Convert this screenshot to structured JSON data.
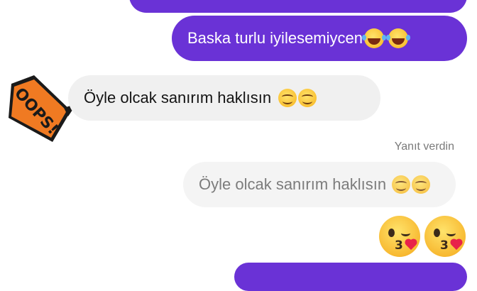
{
  "messages": {
    "sent_top": {
      "text": ""
    },
    "sent_1": {
      "text": "Baska turlu iyilesemiycen",
      "emojis": [
        "face-with-tears-of-joy",
        "face-with-tears-of-joy"
      ]
    },
    "received_1": {
      "text": "Öyle olcak sanırım haklısın",
      "emojis": [
        "smiling-face",
        "smiling-face"
      ]
    },
    "reply_meta": "Yanıt verdin",
    "quoted": {
      "text": "Öyle olcak sanırım haklısın",
      "emojis": [
        "smiling-face",
        "smiling-face"
      ]
    },
    "kisses": [
      "face-blowing-a-kiss",
      "face-blowing-a-kiss"
    ]
  },
  "sticker": {
    "text": "OOPS!",
    "icon": "oops-sticker-icon"
  },
  "colors": {
    "outgoing": "#6a32d6",
    "incoming": "#f0f0f0",
    "quoted": "#f4f4f4",
    "sticker": "#f07a22"
  }
}
